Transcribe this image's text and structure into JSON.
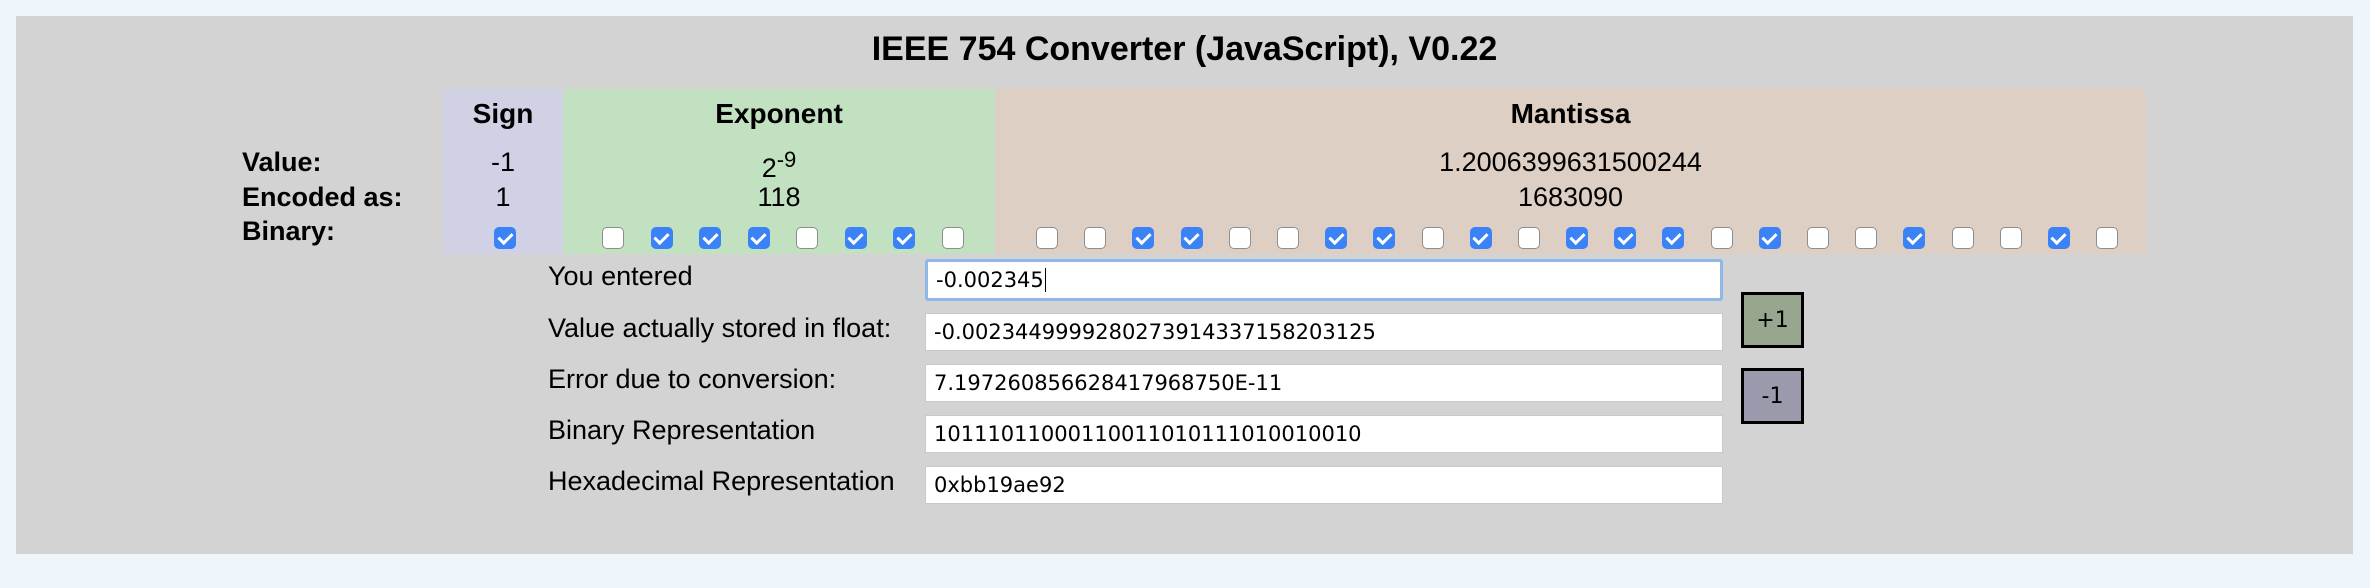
{
  "title": "IEEE 754 Converter (JavaScript), V0.22",
  "columns": {
    "sign": "Sign",
    "exponent": "Exponent",
    "mantissa": "Mantissa"
  },
  "row_labels": {
    "value": "Value:",
    "encoded": "Encoded as:",
    "binary": "Binary:"
  },
  "sign": {
    "value": "-1",
    "encoded": "1",
    "bit": [
      1
    ]
  },
  "exponent": {
    "value_base": "2",
    "value_exp": "-9",
    "encoded": "118",
    "bits": [
      0,
      1,
      1,
      1,
      0,
      1,
      1,
      0
    ]
  },
  "mantissa": {
    "value": "1.2006399631500244",
    "encoded": "1683090",
    "bits": [
      0,
      0,
      1,
      1,
      0,
      0,
      1,
      1,
      0,
      1,
      0,
      1,
      1,
      1,
      0,
      1,
      0,
      0,
      1,
      0,
      0,
      1,
      0
    ]
  },
  "fields": {
    "entered_label": "You entered",
    "entered_value": "-0.002345",
    "stored_label": "Value actually stored in float:",
    "stored_value": "-0.0023449999280273914337158203125",
    "error_label": "Error due to conversion:",
    "error_value": "7.197260856628417968750E-11",
    "binary_label": "Binary Representation",
    "binary_value": "10111011000110011010111010010010",
    "hex_label": "Hexadecimal Representation",
    "hex_value": "0xbb19ae92"
  },
  "buttons": {
    "plus": "+1",
    "minus": "-1"
  },
  "colors": {
    "sign_bg": "#d1d1e6",
    "exponent_bg": "#c1e1c1",
    "mantissa_bg": "#decfc4",
    "checkbox_on": "#3a82f6"
  }
}
